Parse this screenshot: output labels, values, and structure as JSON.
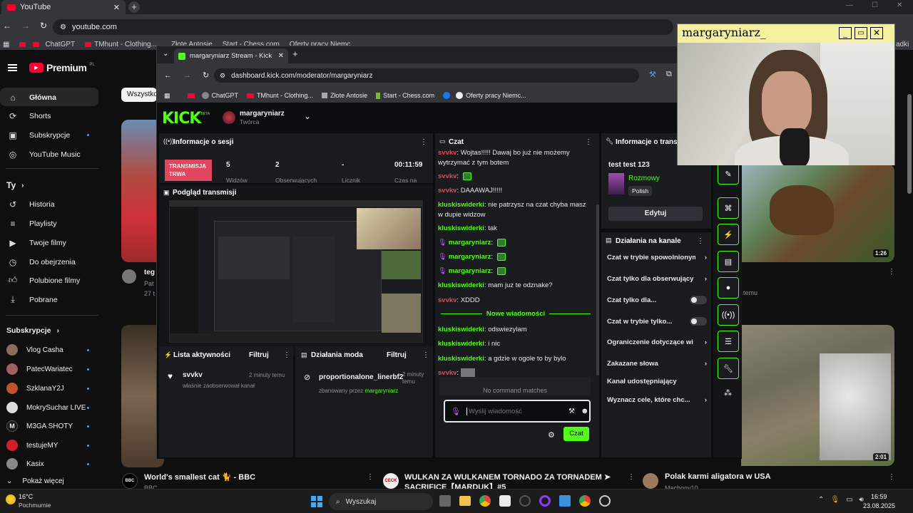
{
  "yt_browser": {
    "tab_title": "YouTube",
    "url": "youtube.com",
    "bookmarks": [
      "ChatGPT",
      "TMhunt - Clothing...",
      "Złote Antosie",
      "Start - Chess.com",
      "Oferty pracy Niemc..."
    ],
    "extra_bookmark_fragment": "adki"
  },
  "youtube": {
    "logo_text": "Premium",
    "logo_badge": "PL",
    "chip_all": "Wszystko",
    "nav": [
      "Główna",
      "Shorts",
      "Subskrypcje",
      "YouTube Music"
    ],
    "you_header": "Ty",
    "you_items": [
      "Historia",
      "Playlisty",
      "Twoje filmy",
      "Do obejrzenia",
      "Polubione filmy",
      "Pobrane"
    ],
    "subs_header": "Subskrypcje",
    "subs": [
      "Vlog Casha",
      "PatecWariatec",
      "SzklanaY2J",
      "MokrySuchar LIVE",
      "M3GA SHOTY",
      "testujeMY",
      "Kasix"
    ],
    "show_more": "Pokaż więcej",
    "partial_left_title": "teg",
    "partial_left_meta1": "Pat",
    "partial_left_meta2": "27 t",
    "right_fragment_text": "temu",
    "durations": [
      "1:26",
      "2:01"
    ],
    "bottom_videos": [
      {
        "title": "World's smallest cat 🐈 - BBC",
        "channel": "BBC",
        "avatar": "BBC"
      },
      {
        "title": "WULKAN ZA WULKANEM TORNADO ZA TORNADEM ➤ SACRIFICE【MARDUK】#5",
        "channel": "",
        "avatar": "CECK"
      },
      {
        "title": "Polak karmi aligatora w USA",
        "channel": "Machony10",
        "avatar": ""
      }
    ]
  },
  "kick_browser": {
    "tab_title": "margaryniarz Stream - Kick Da",
    "url": "dashboard.kick.com/moderator/margaryniarz",
    "bookmarks": [
      "ChatGPT",
      "TMhunt - Clothing...",
      "Złote Antosie",
      "Start - Chess.com",
      "Oferty pracy Niemc..."
    ]
  },
  "kick": {
    "logo": "KICK",
    "logo_badge": "BETA",
    "user": {
      "name": "margaryniarz",
      "role": "Twórca"
    },
    "session": {
      "title": "Informacje o sesji",
      "live_badge": "TRANSMISJA TRWA",
      "stats": [
        {
          "value": "5",
          "label": "Widzów"
        },
        {
          "value": "2",
          "label": "Obserwujących"
        },
        {
          "value": "-",
          "label": "Licznik"
        },
        {
          "value": "00:11:59",
          "label": "Czas na"
        }
      ]
    },
    "preview_title": "Podgląd transmisji",
    "activity": {
      "title": "Lista aktywności",
      "filter": "Filtruj",
      "user": "svvkv",
      "time": "2 minuty temu",
      "desc": "właśnie zaobserwował kanał"
    },
    "modactions": {
      "title": "Działania moda",
      "filter": "Filtruj",
      "user": "proportionalone_linerbf2",
      "time": "2 minuty temu",
      "desc_prefix": "zbanowany przez",
      "desc_by": "margaryniarz"
    },
    "chat": {
      "title": "Czat",
      "messages": [
        {
          "user": "svvkv",
          "text": "Wojtas!!!!! Dawaj bo już nie możemy wytrzymać z tym botem",
          "style": "g"
        },
        {
          "user": "svvkv",
          "text": "",
          "emote": true,
          "style": "g"
        },
        {
          "user": "svvkv",
          "text": "DAAAWAJ!!!!!",
          "style": "g"
        },
        {
          "user": "kluskiswiderki",
          "text": "nie patrzysz na czat chyba masz w dupie widzow",
          "style": "k"
        },
        {
          "user": "kluskiswiderki",
          "text": "tak",
          "style": "k"
        },
        {
          "user": "margaryniarz",
          "text": "",
          "emote": true,
          "style": "m"
        },
        {
          "user": "margaryniarz",
          "text": "",
          "emote": true,
          "style": "m"
        },
        {
          "user": "margaryniarz",
          "text": "",
          "emote": true,
          "style": "m"
        },
        {
          "user": "kluskiswiderki",
          "text": "mam juz te odznake?",
          "style": "k"
        },
        {
          "user": "svvkv",
          "text": "XDDD",
          "style": "g"
        }
      ],
      "new_messages": "Nowe wiadomości",
      "messages_after": [
        {
          "user": "kluskiswiderki",
          "text": "odswiezylam"
        },
        {
          "user": "kluskiswiderki",
          "text": "i nic"
        },
        {
          "user": "kluskiswiderki",
          "text": "a gdzie w ogole to by bylo"
        }
      ],
      "last_user": "svvkv",
      "no_command": "No command matches",
      "input_placeholder": "Wyślij wiadomość",
      "send_label": "Czat"
    },
    "stream_info": {
      "title": "Informacje o transmisji",
      "stream_title": "test test 123",
      "category": "Rozmowy",
      "language": "Polish",
      "edit_label": "Edytuj"
    },
    "channel_actions": {
      "title": "Działania na kanale",
      "rows": [
        {
          "label": "Czat w trybie spowolnionym",
          "kind": "arrow"
        },
        {
          "label": "Czat tylko dla obserwujący",
          "kind": "arrow"
        },
        {
          "label": "Czat tylko dla...",
          "kind": "toggle"
        },
        {
          "label": "Czat w trybie tylko...",
          "kind": "toggle"
        },
        {
          "label": "Ograniczenie dotyczące wi",
          "kind": "arrow"
        },
        {
          "label": "Zakazane słowa",
          "kind": "arrow"
        },
        {
          "label": "Kanał udostępniający",
          "kind": "none"
        },
        {
          "label": "Wyznacz cele, które chc...",
          "kind": "arrow"
        }
      ]
    }
  },
  "cam_window": {
    "title": "margaryniarz_"
  },
  "taskbar": {
    "weather_temp": "16°C",
    "weather_desc": "Pochmurnie",
    "search": "Wyszukaj",
    "time": "16:59",
    "date": "23.08.2025"
  }
}
